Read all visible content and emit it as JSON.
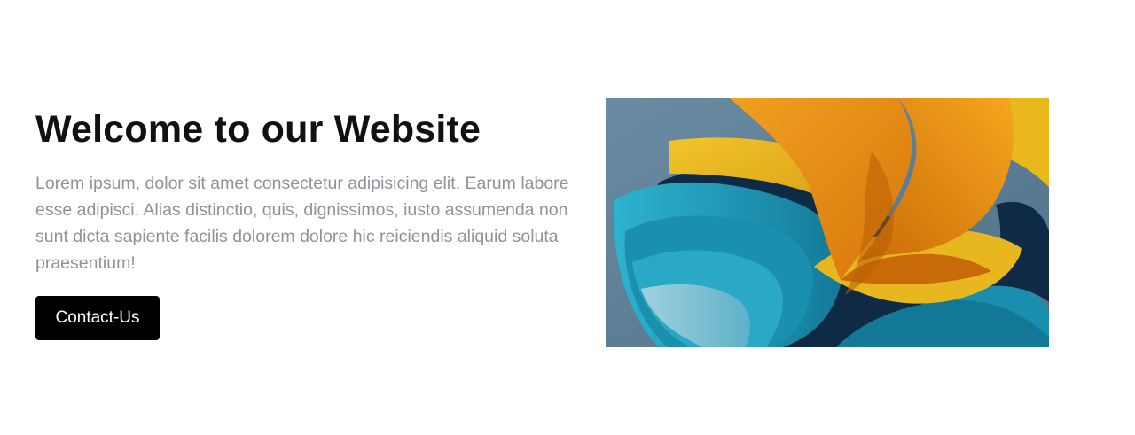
{
  "hero": {
    "title": "Welcome to our Website",
    "description": "Lorem ipsum, dolor sit amet consectetur adipisicing elit. Earum labore esse adipisci. Alias distinctio, quis, dignissimos, iusto assumenda non sunt dicta sapiente facilis dolorem dolore hic reiciendis aliquid soluta praesentium!",
    "button_label": "Contact-Us"
  },
  "colors": {
    "title": "#111111",
    "description": "#8f9399",
    "button_bg": "#000000",
    "button_text": "#ffffff",
    "image_bg": "#5e7f96",
    "image_orange": "#e88a14",
    "image_yellow": "#e9b81d",
    "image_blue": "#1e9ab8",
    "image_navy": "#0f2a44"
  }
}
